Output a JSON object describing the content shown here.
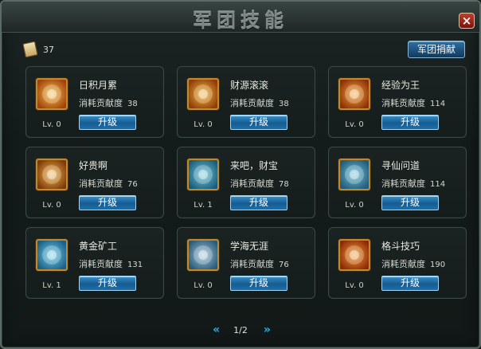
{
  "window": {
    "title": "军团技能",
    "close_label": "×"
  },
  "contribution": {
    "value": "37"
  },
  "donate_label": "军团捐献",
  "skills": [
    {
      "name": "日积月累",
      "cost_label": "消耗贡献度",
      "cost": "38",
      "level": "Lv. 0",
      "button": "升级",
      "icon": "scroll-icon",
      "colors": [
        "#f6c04a",
        "#a2420c"
      ]
    },
    {
      "name": "财源滚滚",
      "cost_label": "消耗贡献度",
      "cost": "38",
      "level": "Lv. 0",
      "button": "升级",
      "icon": "coins-icon",
      "colors": [
        "#f3b43a",
        "#8f3d0b"
      ]
    },
    {
      "name": "经验为王",
      "cost_label": "消耗贡献度",
      "cost": "114",
      "level": "Lv. 0",
      "button": "升级",
      "icon": "exp-icon",
      "colors": [
        "#f5a434",
        "#8d300a"
      ]
    },
    {
      "name": "好贵啊",
      "cost_label": "消耗贡献度",
      "cost": "76",
      "level": "Lv. 0",
      "button": "升级",
      "icon": "money-bag-icon",
      "colors": [
        "#f2b548",
        "#7d3a0b"
      ]
    },
    {
      "name": "来吧，财宝",
      "cost_label": "消耗贡献度",
      "cost": "78",
      "level": "Lv. 1",
      "button": "升级",
      "icon": "dragon-icon",
      "colors": [
        "#6fc9d8",
        "#1b5b7b"
      ]
    },
    {
      "name": "寻仙问道",
      "cost_label": "消耗贡献度",
      "cost": "114",
      "level": "Lv. 0",
      "button": "升级",
      "icon": "sage-icon",
      "colors": [
        "#6ec1d6",
        "#245a7a"
      ]
    },
    {
      "name": "黄金矿工",
      "cost_label": "消耗贡献度",
      "cost": "131",
      "level": "Lv. 1",
      "button": "升级",
      "icon": "shovel-icon",
      "colors": [
        "#6fd0e8",
        "#1d5e86"
      ]
    },
    {
      "name": "学海无涯",
      "cost_label": "消耗贡献度",
      "cost": "76",
      "level": "Lv. 0",
      "button": "升级",
      "icon": "book-scroll-icon",
      "colors": [
        "#9ec5d8",
        "#2c5a77"
      ]
    },
    {
      "name": "格斗技巧",
      "cost_label": "消耗贡献度",
      "cost": "190",
      "level": "Lv. 0",
      "button": "升级",
      "icon": "crossed-swords-icon",
      "colors": [
        "#f29a32",
        "#8d2b08"
      ]
    }
  ],
  "pagination": {
    "text": "1/2",
    "prev": "«",
    "next": "»"
  }
}
